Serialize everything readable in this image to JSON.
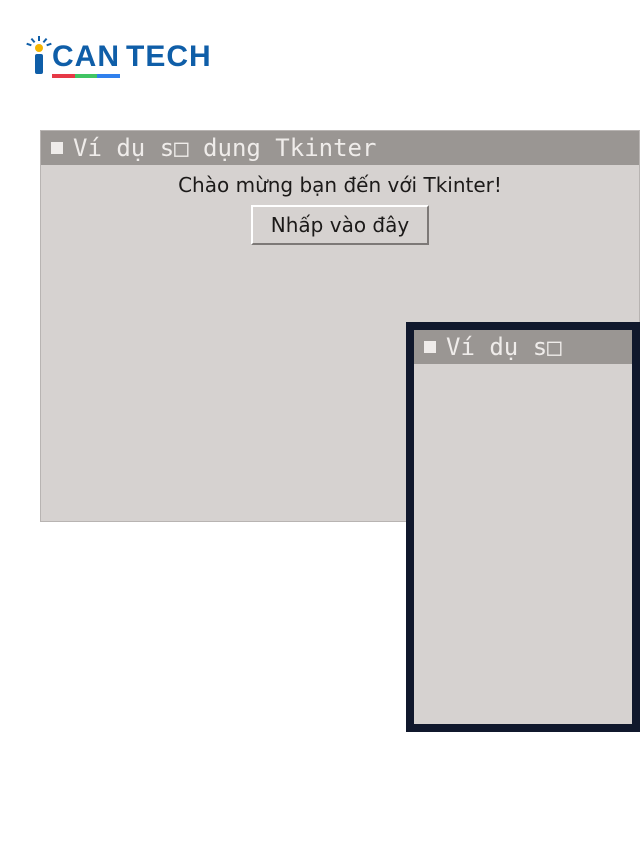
{
  "logo": {
    "word1": {
      "c": "C",
      "a": "A",
      "n": "N"
    },
    "word2": "TECH"
  },
  "window1": {
    "title": "Ví dụ s□ dụng Tkinter",
    "welcome_label": "Chào mừng bạn đến với Tkinter!",
    "button_label": "Nhấp vào đây"
  },
  "window2": {
    "title": "Ví dụ s□"
  }
}
